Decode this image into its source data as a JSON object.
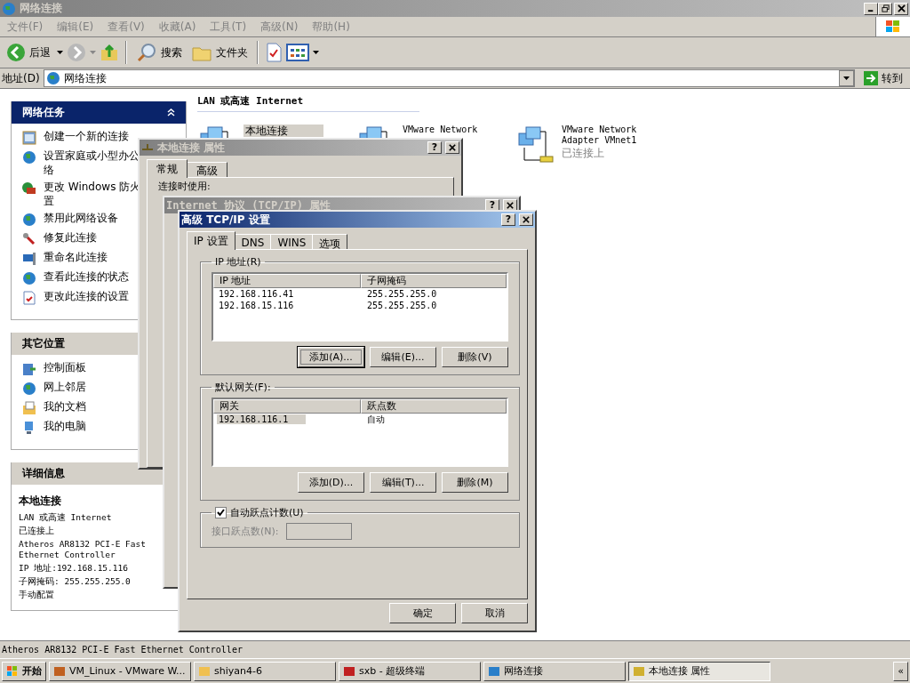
{
  "window": {
    "title": "网络连接"
  },
  "menu": [
    "文件(F)",
    "编辑(E)",
    "查看(V)",
    "收藏(A)",
    "工具(T)",
    "高级(N)",
    "帮助(H)"
  ],
  "toolbar": {
    "back": "后退",
    "search": "搜索",
    "folders": "文件夹"
  },
  "address": {
    "label": "地址(D)",
    "value": "网络连接",
    "go": "转到"
  },
  "tasks": {
    "title": "网络任务",
    "expanded": true,
    "items": [
      {
        "label": "创建一个新的连接",
        "kind": "window"
      },
      {
        "label": "设置家庭或小型办公",
        "kind": "globe"
      },
      {
        "label": "络",
        "kind": "none"
      },
      {
        "label": "更改 Windows 防火",
        "kind": "wall"
      },
      {
        "label": "置",
        "kind": "none"
      },
      {
        "label": "禁用此网络设备",
        "kind": "globe"
      },
      {
        "label": "修复此连接",
        "kind": "wrench"
      },
      {
        "label": "重命名此连接",
        "kind": "monitor"
      },
      {
        "label": "查看此连接的状态",
        "kind": "globe"
      },
      {
        "label": "更改此连接的设置",
        "kind": "document"
      }
    ]
  },
  "other_places": {
    "title": "其它位置",
    "items": [
      {
        "label": "控制面板",
        "kind": "window"
      },
      {
        "label": "网上邻居",
        "kind": "globe"
      },
      {
        "label": "我的文档",
        "kind": "document"
      },
      {
        "label": "我的电脑",
        "kind": "monitor"
      }
    ]
  },
  "details": {
    "title": "详细信息",
    "name": "本地连接",
    "lines": [
      "LAN 或高速 Internet",
      "已连接上",
      "Atheros AR8132 PCI-E Fast Ethernet Controller",
      "IP 地址:192.168.15.116",
      "子网掩码: 255.255.255.0",
      "手动配置"
    ]
  },
  "section_title": "LAN 或高速 Internet",
  "connections": [
    {
      "lines": [
        "本地连接"
      ],
      "selected": true
    },
    {
      "lines": [
        "VMware Network"
      ],
      "selected": false
    },
    {
      "lines": [
        "VMware Network",
        "Adapter VMnet1"
      ],
      "status": "已连接上",
      "selected": false
    }
  ],
  "props_dialog": {
    "title": "本地连接 属性",
    "help": "?",
    "tabs": [
      {
        "label": "常规",
        "selected": true
      },
      {
        "label": "高级",
        "selected": false
      }
    ],
    "connect_using": "连接时使用:"
  },
  "tcpip_dialog": {
    "title": "Internet 协议 (TCP/IP) 属性",
    "help": "?"
  },
  "advanced_dialog": {
    "title": "高级 TCP/IP 设置",
    "help": "?",
    "tabs": [
      {
        "label": "IP 设置",
        "selected": true
      },
      {
        "label": "DNS",
        "selected": false
      },
      {
        "label": "WINS",
        "selected": false
      },
      {
        "label": "选项",
        "selected": false
      }
    ],
    "ip_group": {
      "title": "IP 地址(R)",
      "columns": [
        "IP 地址",
        "子网掩码"
      ],
      "rows": [
        {
          "cells": [
            "192.168.116.41",
            "255.255.255.0"
          ],
          "selected": false
        },
        {
          "cells": [
            "192.168.15.116",
            "255.255.255.0"
          ],
          "selected": false
        }
      ],
      "buttons": [
        "添加(A)...",
        "编辑(E)...",
        "删除(V)"
      ]
    },
    "gateway_group": {
      "title": "默认网关(F):",
      "columns": [
        "网关",
        "跃点数"
      ],
      "rows": [
        {
          "cells": [
            "192.168.116.1",
            "自动"
          ],
          "selected": true
        }
      ],
      "buttons": [
        "添加(D)...",
        "编辑(T)...",
        "删除(M)"
      ]
    },
    "auto_metric": {
      "label": "自动跃点计数(U)",
      "checked": true
    },
    "interface_metric": {
      "label": "接口跃点数(N):",
      "disabled": true
    },
    "buttons": [
      "确定",
      "取消"
    ]
  },
  "status_bar": "Atheros AR8132 PCI-E Fast Ethernet Controller",
  "taskbar": {
    "start": "开始",
    "tasks": [
      {
        "label": "VM_Linux - VMware W...",
        "selected": false
      },
      {
        "label": "shiyan4-6",
        "selected": false
      },
      {
        "label": "sxb - 超级终端",
        "selected": false
      },
      {
        "label": "网络连接",
        "selected": false
      },
      {
        "label": "本地连接 属性",
        "selected": true
      }
    ],
    "more": "«"
  }
}
